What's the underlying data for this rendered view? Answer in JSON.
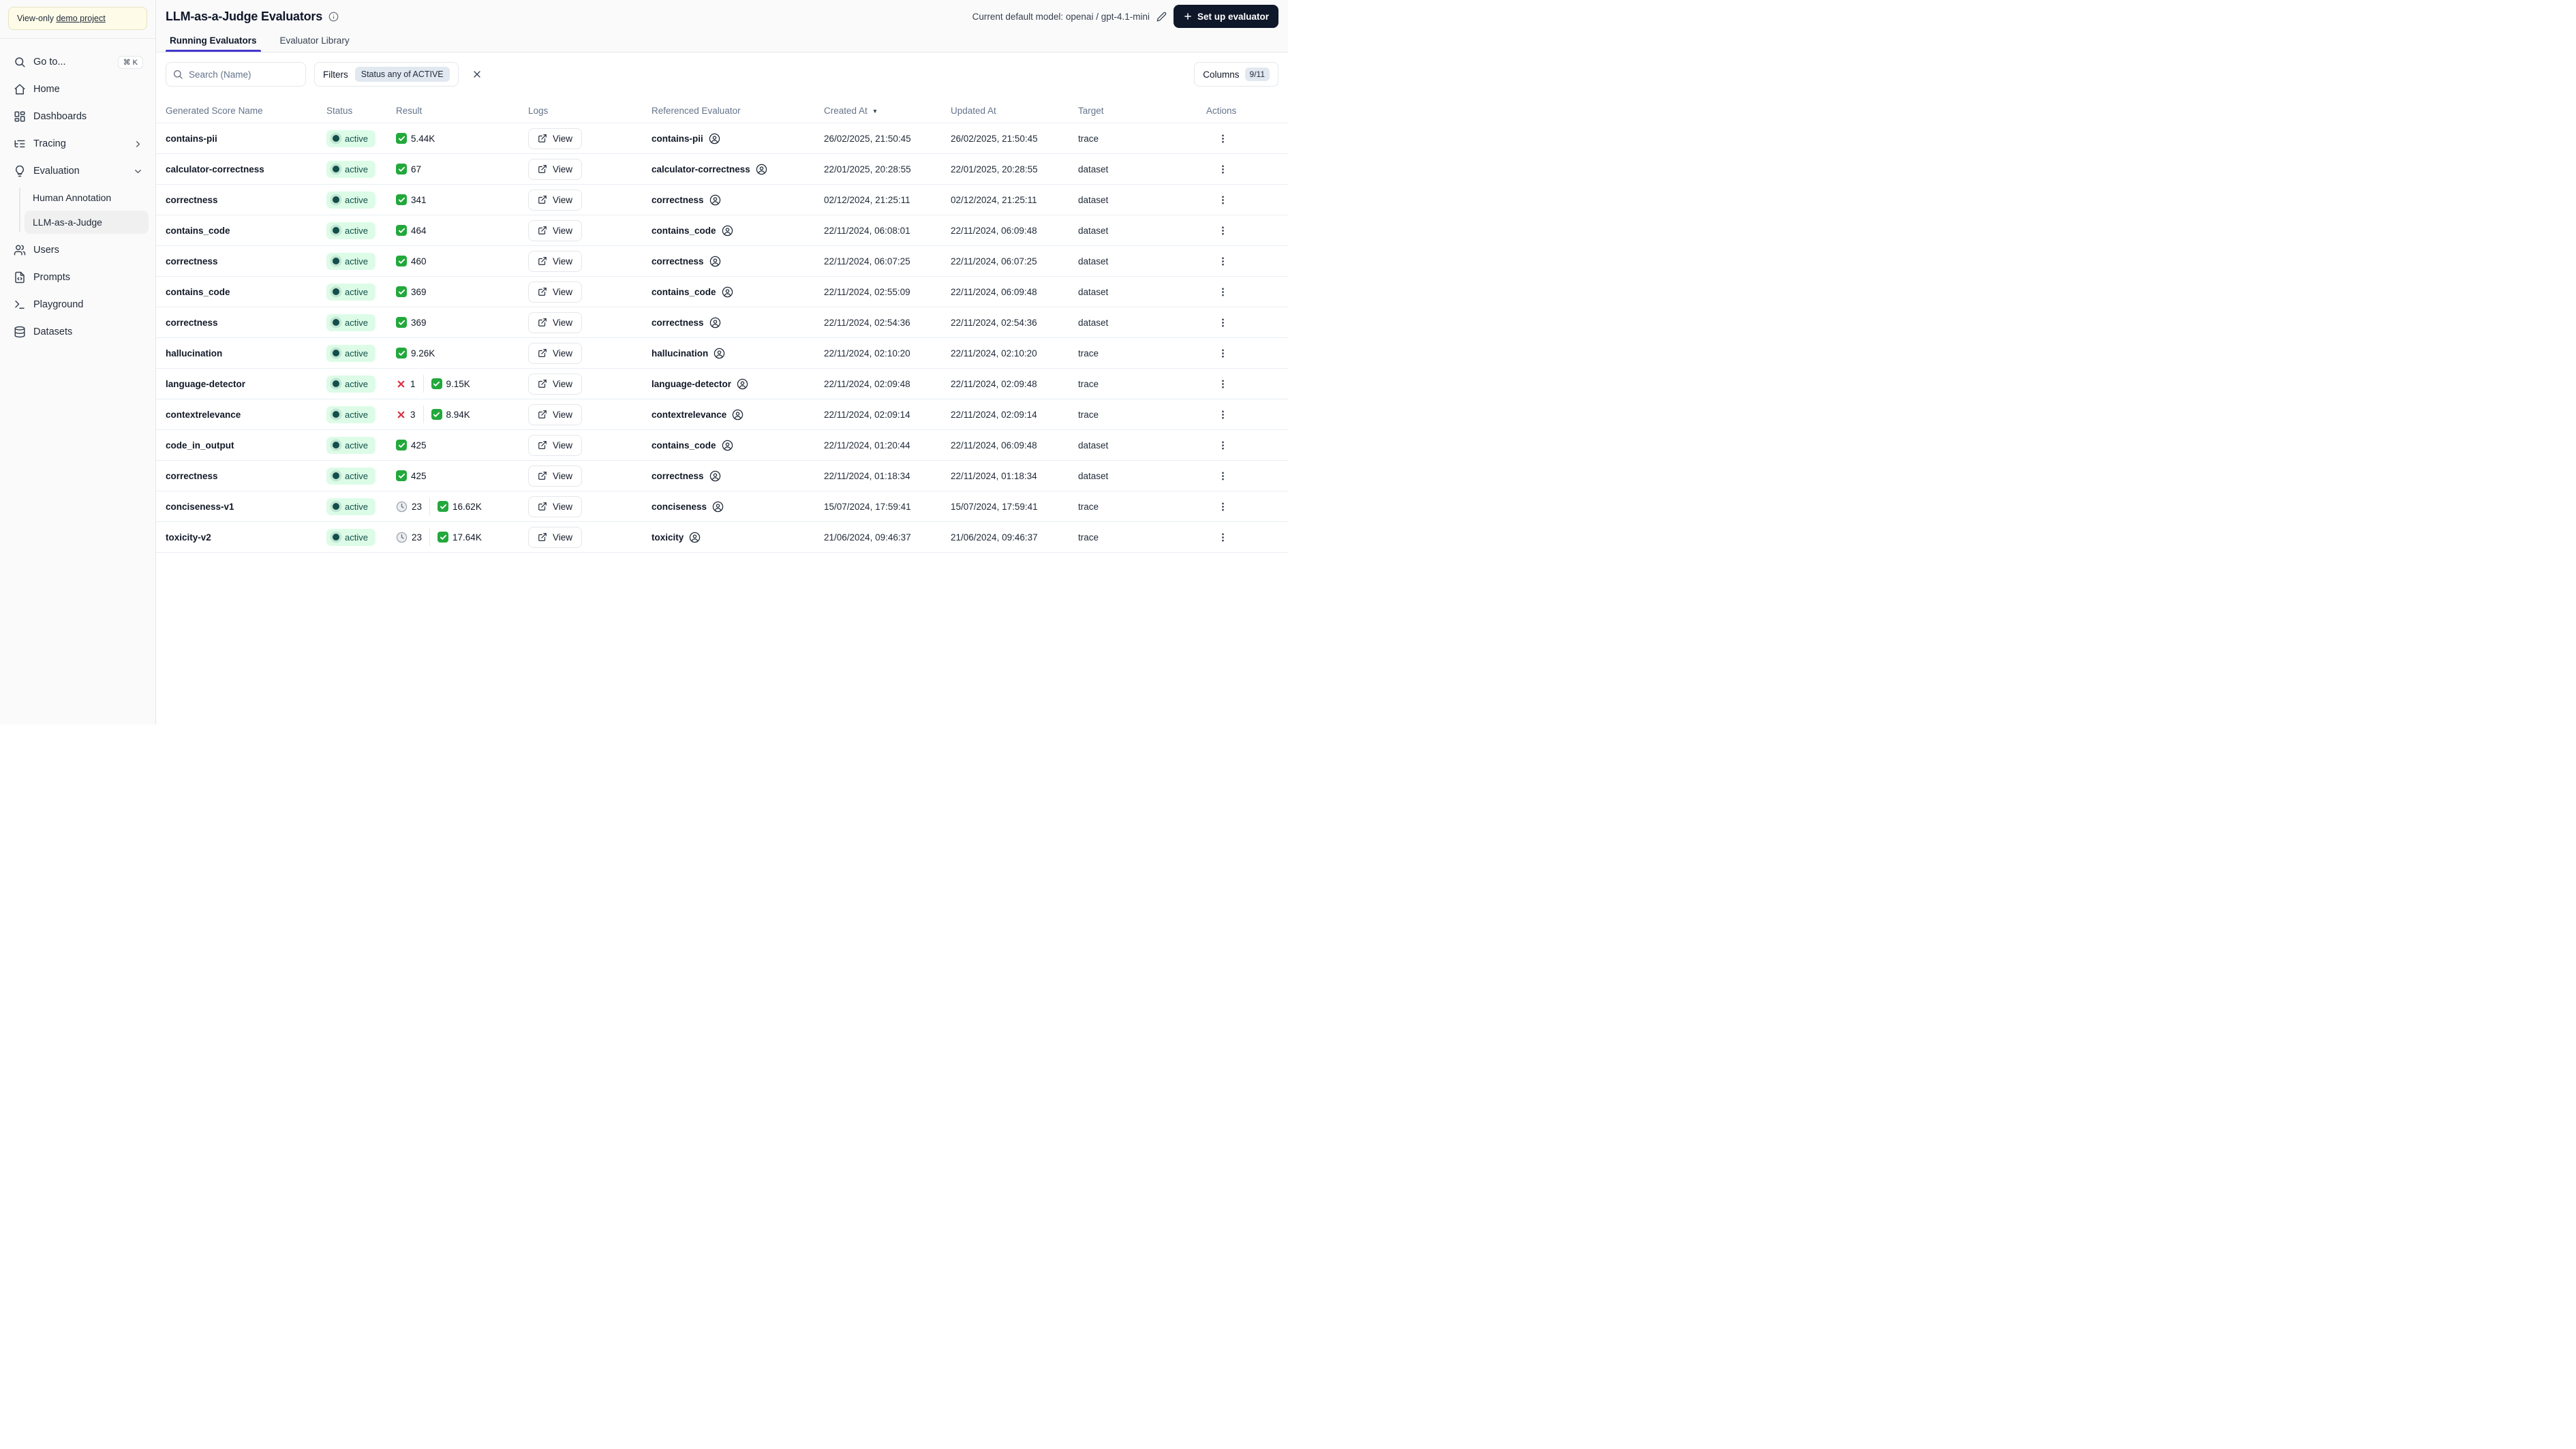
{
  "sidebar": {
    "banner": {
      "prefix": "View-only ",
      "link": "demo project"
    },
    "items": [
      {
        "label": "Go to...",
        "icon": "search",
        "shortcut": "⌘ K"
      },
      {
        "label": "Home",
        "icon": "home"
      },
      {
        "label": "Dashboards",
        "icon": "dashboards"
      },
      {
        "label": "Tracing",
        "icon": "tracing",
        "chevron": "right"
      },
      {
        "label": "Evaluation",
        "icon": "evaluation",
        "chevron": "down",
        "children": [
          {
            "label": "Human Annotation",
            "active": false
          },
          {
            "label": "LLM-as-a-Judge",
            "active": true
          }
        ]
      },
      {
        "label": "Users",
        "icon": "users"
      },
      {
        "label": "Prompts",
        "icon": "prompts"
      },
      {
        "label": "Playground",
        "icon": "playground"
      },
      {
        "label": "Datasets",
        "icon": "datasets"
      }
    ]
  },
  "header": {
    "title": "LLM-as-a-Judge Evaluators",
    "model_label": "Current default model: openai / gpt-4.1-mini",
    "setup_button": "Set up evaluator",
    "tabs": [
      {
        "label": "Running Evaluators",
        "active": true
      },
      {
        "label": "Evaluator Library",
        "active": false
      }
    ]
  },
  "toolbar": {
    "search_placeholder": "Search (Name)",
    "filters_label": "Filters",
    "filter_chip": "Status any of ACTIVE",
    "columns_label": "Columns",
    "columns_badge": "9/11"
  },
  "table": {
    "columns": [
      "Generated Score Name",
      "Status",
      "Result",
      "Logs",
      "Referenced Evaluator",
      "Created At",
      "Updated At",
      "Target",
      "Actions"
    ],
    "sorted_column": "Created At",
    "sort_direction": "desc",
    "logs_button_label": "View",
    "rows": [
      {
        "name": "contains-pii",
        "status": "active",
        "result": {
          "success": "5.44K"
        },
        "referenced": "contains-pii",
        "created": "26/02/2025, 21:50:45",
        "updated": "26/02/2025, 21:50:45",
        "target": "trace"
      },
      {
        "name": "calculator-correctness",
        "status": "active",
        "result": {
          "success": "67"
        },
        "referenced": "calculator-correctness",
        "created": "22/01/2025, 20:28:55",
        "updated": "22/01/2025, 20:28:55",
        "target": "dataset"
      },
      {
        "name": "correctness",
        "status": "active",
        "result": {
          "success": "341"
        },
        "referenced": "correctness",
        "created": "02/12/2024, 21:25:11",
        "updated": "02/12/2024, 21:25:11",
        "target": "dataset"
      },
      {
        "name": "contains_code",
        "status": "active",
        "result": {
          "success": "464"
        },
        "referenced": "contains_code",
        "created": "22/11/2024, 06:08:01",
        "updated": "22/11/2024, 06:09:48",
        "target": "dataset"
      },
      {
        "name": "correctness",
        "status": "active",
        "result": {
          "success": "460"
        },
        "referenced": "correctness",
        "created": "22/11/2024, 06:07:25",
        "updated": "22/11/2024, 06:07:25",
        "target": "dataset"
      },
      {
        "name": "contains_code",
        "status": "active",
        "result": {
          "success": "369"
        },
        "referenced": "contains_code",
        "created": "22/11/2024, 02:55:09",
        "updated": "22/11/2024, 06:09:48",
        "target": "dataset"
      },
      {
        "name": "correctness",
        "status": "active",
        "result": {
          "success": "369"
        },
        "referenced": "correctness",
        "created": "22/11/2024, 02:54:36",
        "updated": "22/11/2024, 02:54:36",
        "target": "dataset"
      },
      {
        "name": "hallucination",
        "status": "active",
        "result": {
          "success": "9.26K"
        },
        "referenced": "hallucination",
        "created": "22/11/2024, 02:10:20",
        "updated": "22/11/2024, 02:10:20",
        "target": "trace"
      },
      {
        "name": "language-detector",
        "status": "active",
        "result": {
          "error": "1",
          "success": "9.15K"
        },
        "referenced": "language-detector",
        "created": "22/11/2024, 02:09:48",
        "updated": "22/11/2024, 02:09:48",
        "target": "trace"
      },
      {
        "name": "contextrelevance",
        "status": "active",
        "result": {
          "error": "3",
          "success": "8.94K"
        },
        "referenced": "contextrelevance",
        "created": "22/11/2024, 02:09:14",
        "updated": "22/11/2024, 02:09:14",
        "target": "trace"
      },
      {
        "name": "code_in_output",
        "status": "active",
        "result": {
          "success": "425"
        },
        "referenced": "contains_code",
        "created": "22/11/2024, 01:20:44",
        "updated": "22/11/2024, 06:09:48",
        "target": "dataset"
      },
      {
        "name": "correctness",
        "status": "active",
        "result": {
          "success": "425"
        },
        "referenced": "correctness",
        "created": "22/11/2024, 01:18:34",
        "updated": "22/11/2024, 01:18:34",
        "target": "dataset"
      },
      {
        "name": "conciseness-v1",
        "status": "active",
        "result": {
          "pending": "23",
          "success": "16.62K"
        },
        "referenced": "conciseness",
        "created": "15/07/2024, 17:59:41",
        "updated": "15/07/2024, 17:59:41",
        "target": "trace"
      },
      {
        "name": "toxicity-v2",
        "status": "active",
        "result": {
          "pending": "23",
          "success": "17.64K"
        },
        "referenced": "toxicity",
        "created": "21/06/2024, 09:46:37",
        "updated": "21/06/2024, 09:46:37",
        "target": "trace"
      }
    ]
  },
  "colors": {
    "accent_tab": "#4338ca",
    "primary_button_bg": "#0f172a",
    "status_badge_bg": "#dcfce7",
    "status_badge_text": "#134e4a",
    "success_icon": "#23a83c",
    "error_icon": "#dd2e44",
    "pending_icon": "#9ca3af",
    "banner_bg": "#fefce8",
    "filter_chip_bg": "#e2e8f0",
    "sidebar_bg": "#fafafa"
  }
}
